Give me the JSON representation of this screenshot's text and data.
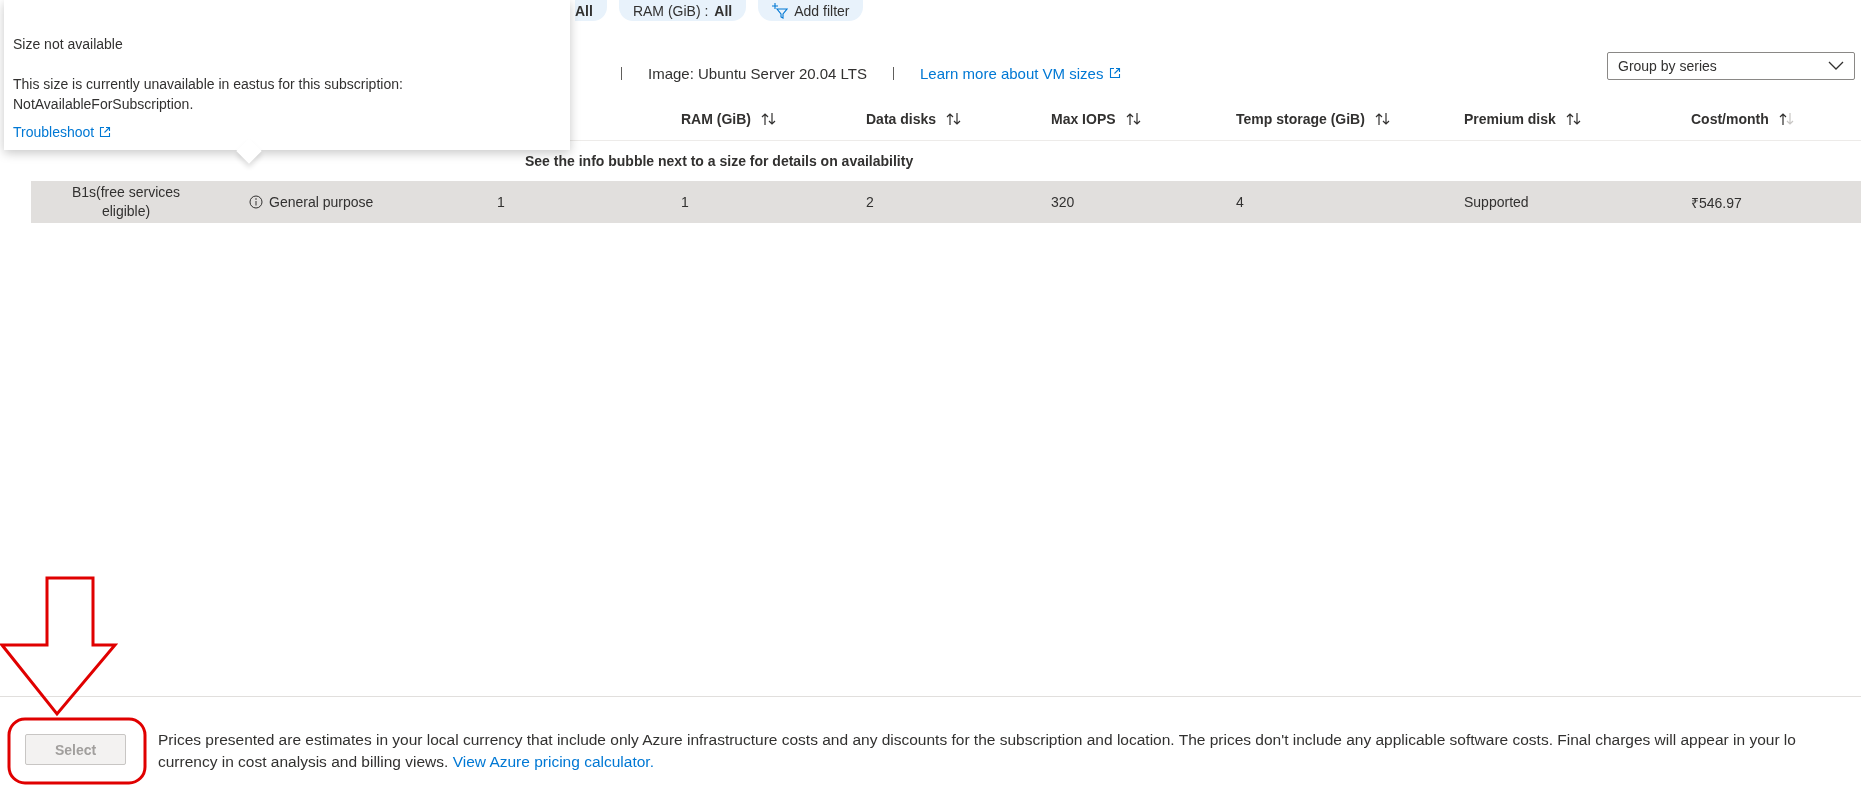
{
  "tooltip": {
    "title": "Size not available",
    "message": "This size is currently unavailable in eastus for this subscription: NotAvailableForSubscription.",
    "link": "Troubleshoot"
  },
  "filters": [
    {
      "kind": "partial",
      "value": "All"
    },
    {
      "kind": "pill",
      "name": "RAM (GiB) :",
      "value": "All"
    },
    {
      "kind": "add",
      "name": "Add filter"
    }
  ],
  "info_bar": {
    "image": "Image: Ubuntu Server 20.04 LTS",
    "link": "Learn more about VM sizes"
  },
  "group_by": {
    "value": "Group by series"
  },
  "table": {
    "columns": [
      {},
      {},
      {},
      {
        "label": "RAM (GiB)",
        "sorted": false
      },
      {
        "label": "Data disks",
        "sorted": false
      },
      {
        "label": "Max IOPS",
        "sorted": false
      },
      {
        "label": "Temp storage (GiB)",
        "sorted": false
      },
      {
        "label": "Premium disk",
        "sorted": false
      },
      {
        "label": "Cost/month",
        "sorted": true
      }
    ],
    "group": {
      "label": "See the info bubble next to a size for details on availability"
    },
    "rows": [
      {
        "selected": true,
        "cells": [
          "B1s(free services eligible)",
          "General purpose",
          "1",
          "1",
          "2",
          "320",
          "4",
          "Supported",
          "₹546.97"
        ]
      }
    ]
  },
  "footer": {
    "button": {
      "label": "Select",
      "disabled": true
    },
    "notice_line_1": "Prices presented are estimates in your local currency that include only Azure infrastructure costs and any discounts for the subscription and location. The prices don't include any applicable software costs. Final charges will appear in your lo",
    "notice_line_2": "currency in cost analysis and billing views.",
    "notice_link": "View Azure pricing calculator."
  }
}
